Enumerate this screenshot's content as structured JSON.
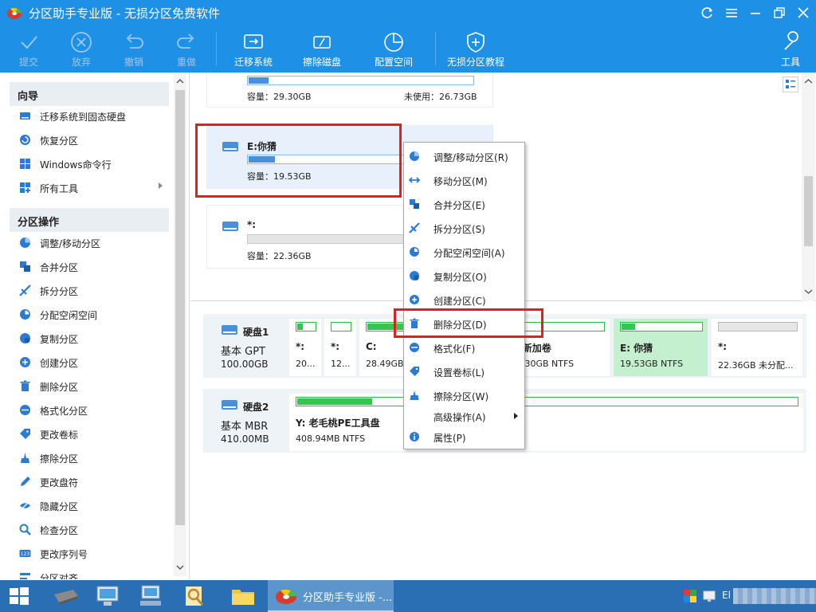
{
  "window": {
    "title": "分区助手专业版 - 无损分区免费软件"
  },
  "toolbar": {
    "items": [
      {
        "label": "提交",
        "icon": "check-icon",
        "enabled": false
      },
      {
        "label": "放弃",
        "icon": "close-circle-icon",
        "enabled": false
      },
      {
        "label": "撤销",
        "icon": "undo-icon",
        "enabled": false
      },
      {
        "label": "重做",
        "icon": "redo-icon",
        "enabled": false
      },
      {
        "label": "迁移系统",
        "icon": "migrate-icon",
        "enabled": true
      },
      {
        "label": "擦除磁盘",
        "icon": "wipe-disk-icon",
        "enabled": true
      },
      {
        "label": "配置空间",
        "icon": "allocate-space-icon",
        "enabled": true
      },
      {
        "label": "无损分区教程",
        "icon": "shield-icon",
        "enabled": true
      },
      {
        "label": "工具",
        "icon": "wrench-icon",
        "enabled": true
      }
    ]
  },
  "sidebar": {
    "wizard_title": "向导",
    "wizard_items": [
      {
        "label": "迁移系统到固态硬盘",
        "icon": "migrate-ssd-icon"
      },
      {
        "label": "恢复分区",
        "icon": "recover-icon"
      },
      {
        "label": "Windows命令行",
        "icon": "windows-icon"
      },
      {
        "label": "所有工具",
        "icon": "all-tools-icon",
        "submenu": true
      }
    ],
    "ops_title": "分区操作",
    "ops_items": [
      {
        "label": "调整/移动分区",
        "icon": "resize-icon"
      },
      {
        "label": "合并分区",
        "icon": "merge-icon"
      },
      {
        "label": "拆分分区",
        "icon": "split-icon"
      },
      {
        "label": "分配空闲空间",
        "icon": "allocate-icon"
      },
      {
        "label": "复制分区",
        "icon": "copy-icon"
      },
      {
        "label": "创建分区",
        "icon": "create-icon"
      },
      {
        "label": "删除分区",
        "icon": "trash-icon"
      },
      {
        "label": "格式化分区",
        "icon": "format-icon"
      },
      {
        "label": "更改卷标",
        "icon": "tag-icon"
      },
      {
        "label": "擦除分区",
        "icon": "wipe-icon"
      },
      {
        "label": "更改盘符",
        "icon": "pen-icon"
      },
      {
        "label": "隐藏分区",
        "icon": "hide-icon"
      },
      {
        "label": "检查分区",
        "icon": "check-partition-icon"
      },
      {
        "label": "更改序列号",
        "icon": "serial-icon"
      },
      {
        "label": "分区对齐",
        "icon": "align-icon"
      }
    ]
  },
  "partition_cards": [
    {
      "name": "",
      "capacity": "容量：29.30GB",
      "unused": "未使用：26.73GB",
      "fill": 0.09
    },
    {
      "name": "E:你猜",
      "capacity": "容量：19.53GB",
      "unused": "",
      "fill": 0.17
    },
    {
      "name": "*:",
      "capacity": "容量：22.36GB",
      "unused": "",
      "fill": 0.0
    }
  ],
  "disks": [
    {
      "name": "硬盘1",
      "type": "基本 GPT",
      "size": "100.00GB",
      "segments": [
        {
          "name": "*:",
          "info": "20...",
          "fill": 0.3
        },
        {
          "name": "*:",
          "info": "12...",
          "fill": 0.0
        },
        {
          "name": "C:",
          "info": "28.49GB NTFS",
          "fill": 0.55
        },
        {
          "name": "D:新加卷",
          "info": "29.30GB NTFS",
          "fill": 0.09
        },
        {
          "name": "E: 你猜",
          "info": "19.53GB NTFS",
          "fill": 0.17
        },
        {
          "name": "*:",
          "info": "22.36GB 未分配...",
          "fill": 0.0
        }
      ]
    },
    {
      "name": "硬盘2",
      "type": "基本 MBR",
      "size": "410.00MB",
      "segments": [
        {
          "name": "Y: 老毛桃PE工具盘",
          "info": "408.94MB NTFS",
          "fill": 0.15
        }
      ]
    }
  ],
  "context_menu": [
    {
      "label": "调整/移动分区(R)",
      "icon": "resize-icon"
    },
    {
      "label": "移动分区(M)",
      "icon": "move-icon"
    },
    {
      "label": "合并分区(E)",
      "icon": "merge-icon"
    },
    {
      "label": "拆分分区(S)",
      "icon": "split-icon"
    },
    {
      "label": "分配空闲空间(A)",
      "icon": "allocate-icon"
    },
    {
      "label": "复制分区(O)",
      "icon": "copy-icon"
    },
    {
      "label": "创建分区(C)",
      "icon": "create-icon"
    },
    {
      "label": "删除分区(D)",
      "icon": "trash-icon"
    },
    {
      "label": "格式化(F)",
      "icon": "format-icon"
    },
    {
      "label": "设置卷标(L)",
      "icon": "tag-icon"
    },
    {
      "label": "擦除分区(W)",
      "icon": "wipe-icon"
    },
    {
      "label": "高级操作(A)",
      "icon": "",
      "submenu": true
    },
    {
      "label": "属性(P)",
      "icon": "info-icon"
    }
  ],
  "taskbar": {
    "active_label": "分区助手专业版 -...",
    "tray_text": "El"
  },
  "colors": {
    "accent": "#1e90e6",
    "highlight": "#e0201e",
    "usage_bar": "#4a90d9",
    "disk_bar": "#32c850"
  }
}
